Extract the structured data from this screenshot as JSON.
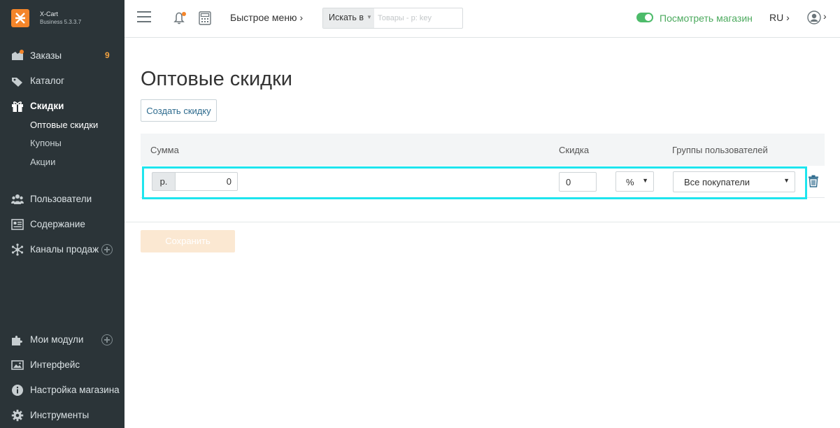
{
  "brand": {
    "name": "X-Cart",
    "version": "Business 5.3.3.7"
  },
  "sidebar": {
    "items": [
      {
        "label": "Заказы",
        "badge": "9",
        "icon": "orders-icon"
      },
      {
        "label": "Каталог",
        "icon": "tag-icon"
      },
      {
        "label": "Скидки",
        "icon": "gift-icon"
      },
      {
        "label": "Пользователи",
        "icon": "users-icon"
      },
      {
        "label": "Содержание",
        "icon": "content-icon"
      },
      {
        "label": "Каналы продаж",
        "icon": "sales-channels-icon"
      },
      {
        "label": "Мои модули",
        "icon": "puzzle-icon"
      },
      {
        "label": "Интерфейс",
        "icon": "image-icon"
      },
      {
        "label": "Настройка магазина",
        "icon": "info-icon"
      },
      {
        "label": "Инструменты",
        "icon": "gear-icon"
      }
    ],
    "discount_subitems": [
      "Оптовые скидки",
      "Купоны",
      "Акции"
    ]
  },
  "topbar": {
    "quick_menu": "Быстрое меню",
    "search": {
      "by_label": "Искать в",
      "placeholder": "Товары - p: key"
    },
    "view_store": "Посмотреть магазин",
    "language": "RU"
  },
  "main": {
    "title": "Оптовые скидки",
    "create_button": "Создать скидку",
    "columns": [
      "Сумма",
      "Скидка",
      "Группы пользователей"
    ],
    "row": {
      "currency_symbol": "р.",
      "amount": "0",
      "discount": "0",
      "discount_type": "%",
      "user_group": "Все покупатели"
    },
    "save_button": "Сохранить"
  },
  "colors": {
    "sidebar_bg": "#2b3438",
    "accent": "#f4852a",
    "highlight": "#1ee5ee",
    "store_link": "#4caa5e"
  }
}
